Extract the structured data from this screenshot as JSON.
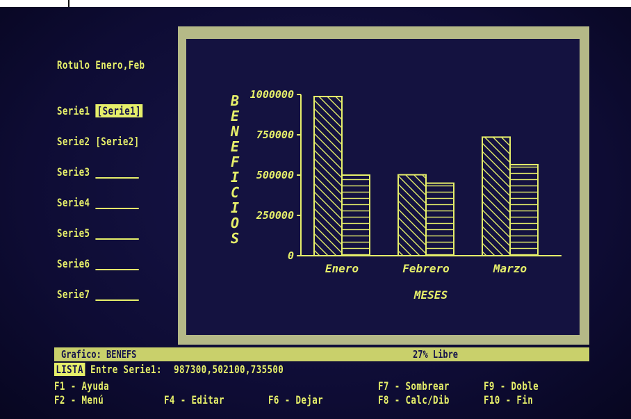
{
  "left_panel": {
    "title": "Rotulo Enero,Feb",
    "series": [
      {
        "label": "Serie1",
        "value": "[Serie1]"
      },
      {
        "label": "Serie2",
        "value": "[Serie2]"
      },
      {
        "label": "Serie3",
        "value": ""
      },
      {
        "label": "Serie4",
        "value": ""
      },
      {
        "label": "Serie5",
        "value": ""
      },
      {
        "label": "Serie6",
        "value": ""
      },
      {
        "label": "Serie7",
        "value": ""
      }
    ]
  },
  "chart_data": {
    "type": "bar",
    "categories": [
      "Enero",
      "Febrero",
      "Marzo"
    ],
    "series": [
      {
        "name": "Serie1",
        "values": [
          987300,
          502100,
          735500
        ]
      },
      {
        "name": "Serie2",
        "values": [
          500000,
          450000,
          565000
        ]
      }
    ],
    "ylabel": "BENEFICIOS",
    "xlabel": "MESES",
    "yticks": [
      "1000000",
      "750000",
      "500000",
      "250000",
      "0"
    ],
    "ylim": [
      0,
      1000000
    ],
    "grid": false
  },
  "status": {
    "graph_label": "Grafico: BENEFS",
    "free_label": "27% Libre"
  },
  "input_line": {
    "mode": "LISTA",
    "prompt": "Entre Serie1:",
    "value": "987300,502100,735500"
  },
  "function_keys": [
    {
      "key": "F1",
      "label": "Ayuda"
    },
    {
      "key": "F2",
      "label": "Menú"
    },
    {
      "key": "F4",
      "label": "Editar"
    },
    {
      "key": "F6",
      "label": "Dejar"
    },
    {
      "key": "F7",
      "label": "Sombrear"
    },
    {
      "key": "F8",
      "label": "Calc/Dib"
    },
    {
      "key": "F9",
      "label": "Doble"
    },
    {
      "key": "F10",
      "label": "Fin"
    }
  ],
  "colors": {
    "text": "#e6ef6a",
    "screen_bg": "#141240",
    "frame": "#b5b987",
    "status_bar": "#c9d06b"
  }
}
